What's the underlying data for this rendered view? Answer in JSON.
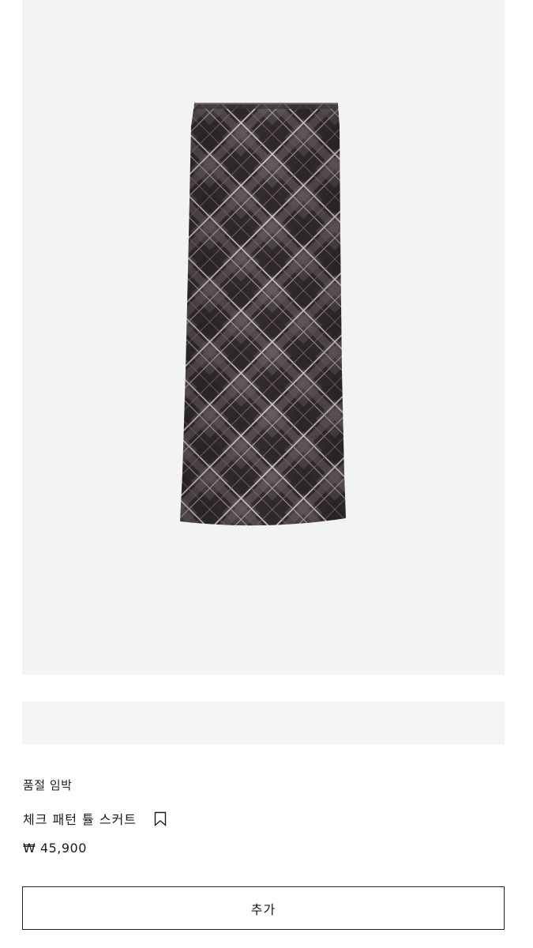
{
  "product": {
    "image_icon": "plaid-skirt-image",
    "stock_status": "품절 임박",
    "name": "체크 패턴 튤 스커트",
    "bookmark_icon": "bookmark-icon",
    "price": "₩ 45,900",
    "add_label": "추가"
  },
  "colors": {
    "image_background": "#f3f3f3",
    "skirt_base": "#4a4346",
    "skirt_dark_check": "#2a2427",
    "skirt_light_line": "#d9cfd2",
    "button_border": "#222222"
  }
}
